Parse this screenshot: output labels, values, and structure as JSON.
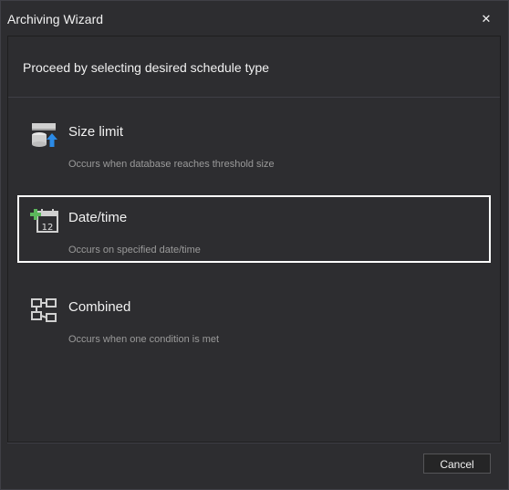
{
  "window": {
    "title": "Archiving Wizard",
    "close_glyph": "✕"
  },
  "header": {
    "text": "Proceed by selecting desired schedule type"
  },
  "options": [
    {
      "icon": "database-upload-icon",
      "title": "Size limit",
      "description": "Occurs when database reaches threshold size",
      "selected": false
    },
    {
      "icon": "calendar-add-icon",
      "title": "Date/time",
      "description": "Occurs on specified date/time",
      "selected": true
    },
    {
      "icon": "flow-diagram-icon",
      "title": "Combined",
      "description": "Occurs when one condition is met",
      "selected": false
    }
  ],
  "calendar_day": "12",
  "footer": {
    "cancel_label": "Cancel"
  },
  "colors": {
    "background": "#2d2d30",
    "selection_border": "#ffffff",
    "accent_blue": "#2b8ae6",
    "accent_green": "#5cb85c"
  }
}
